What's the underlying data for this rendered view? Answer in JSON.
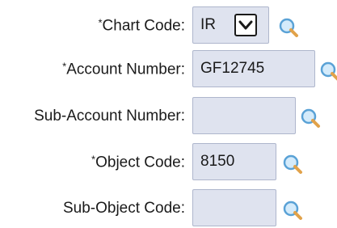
{
  "form": {
    "required_mark": "*",
    "fields": [
      {
        "label": "Chart Code:",
        "required": true,
        "value": "IR",
        "type": "select",
        "icon": "search-icon"
      },
      {
        "label": "Account Number:",
        "required": true,
        "value": "GF12745",
        "type": "text",
        "icon": "search-icon"
      },
      {
        "label": "Sub-Account Number:",
        "required": false,
        "value": "",
        "type": "text",
        "icon": "search-icon"
      },
      {
        "label": "Object Code:",
        "required": true,
        "value": "8150",
        "type": "text",
        "icon": "search-icon"
      },
      {
        "label": "Sub-Object Code:",
        "required": false,
        "value": "",
        "type": "text",
        "icon": "search-icon"
      }
    ]
  },
  "colors": {
    "field_bg": "#dfe3ef",
    "field_border": "#aeb6cc",
    "icon_accent": "#5aa2d6",
    "icon_handle": "#e1a24a"
  }
}
